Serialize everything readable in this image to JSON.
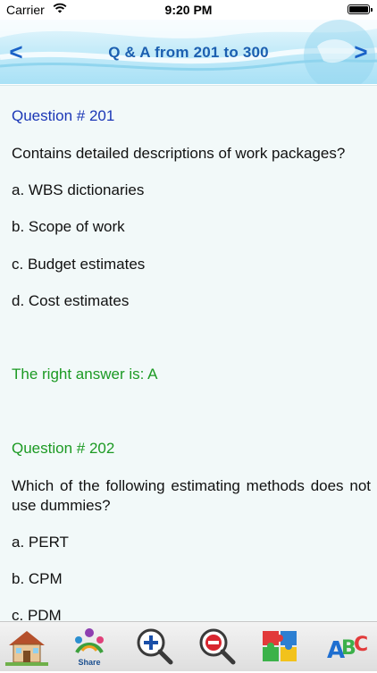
{
  "status_bar": {
    "carrier": "Carrier",
    "time": "9:20 PM"
  },
  "header": {
    "title": "Q & A from 201 to 300",
    "back_icon": "<",
    "forward_icon": ">"
  },
  "questions": [
    {
      "title": "Question # 201",
      "text": "Contains detailed descriptions of work packages?",
      "options": [
        "a. WBS dictionaries",
        "b. Scope of work",
        "c. Budget estimates",
        "d. Cost estimates"
      ],
      "answer": "The right answer is: A"
    },
    {
      "title": "Question # 202",
      "text": "Which of the following estimating methods does not use dummies?",
      "options": [
        "a. PERT",
        "b. CPM",
        "c. PDM"
      ]
    }
  ],
  "toolbar": {
    "share_label": "Share",
    "items": [
      "home-icon",
      "share-icon",
      "zoom-in-icon",
      "zoom-out-icon",
      "puzzle-icon",
      "abc-icon"
    ]
  },
  "colors": {
    "question_blue": "#1b37b6",
    "answer_green": "#1c9a23",
    "header_title": "#1c5fb0"
  }
}
